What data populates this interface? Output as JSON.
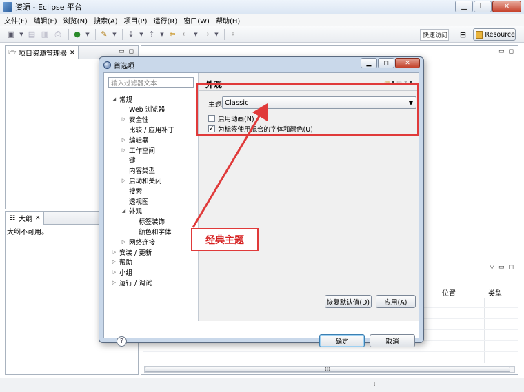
{
  "window": {
    "title": "资源 - Eclipse 平台"
  },
  "menu": [
    "文件(F)",
    "编辑(E)",
    "浏览(N)",
    "搜索(A)",
    "项目(P)",
    "运行(R)",
    "窗口(W)",
    "帮助(H)"
  ],
  "toolbar": {
    "quick_access": "快速访问",
    "perspective_label": "Resource"
  },
  "project_explorer": {
    "title": "项目资源管理器"
  },
  "outline": {
    "title": "大纲",
    "message": "大纲不可用。"
  },
  "table": {
    "columns": [
      "位置",
      "类型"
    ]
  },
  "dialog": {
    "title": "首选项",
    "filter_placeholder": "输入过滤器文本",
    "tree": [
      {
        "label": "常规",
        "toggle": "◢",
        "level": 0
      },
      {
        "label": "Web 浏览器",
        "toggle": "",
        "level": 1
      },
      {
        "label": "安全性",
        "toggle": "▷",
        "level": 1
      },
      {
        "label": "比较 / 应用补丁",
        "toggle": "",
        "level": 1
      },
      {
        "label": "编辑器",
        "toggle": "▷",
        "level": 1
      },
      {
        "label": "工作空间",
        "toggle": "▷",
        "level": 1
      },
      {
        "label": "键",
        "toggle": "",
        "level": 1
      },
      {
        "label": "内容类型",
        "toggle": "",
        "level": 1
      },
      {
        "label": "启动和关闭",
        "toggle": "▷",
        "level": 1
      },
      {
        "label": "搜索",
        "toggle": "",
        "level": 1
      },
      {
        "label": "透视图",
        "toggle": "",
        "level": 1
      },
      {
        "label": "外观",
        "toggle": "◢",
        "level": 1
      },
      {
        "label": "标签装饰",
        "toggle": "",
        "level": 2
      },
      {
        "label": "颜色和字体",
        "toggle": "",
        "level": 2
      },
      {
        "label": "网络连接",
        "toggle": "▷",
        "level": 1
      },
      {
        "label": "安装 / 更新",
        "toggle": "▷",
        "level": 0
      },
      {
        "label": "帮助",
        "toggle": "▷",
        "level": 0
      },
      {
        "label": "小组",
        "toggle": "▷",
        "level": 0
      },
      {
        "label": "运行 / 调试",
        "toggle": "▷",
        "level": 0
      }
    ],
    "page_title": "外观",
    "theme_label": "主题",
    "theme_value": "Classic",
    "enable_animations": {
      "label": "启用动画(N)",
      "checked": false
    },
    "mixed_fonts": {
      "label": "为标签使用混合的字体和颜色(U)",
      "checked": true
    },
    "restore_defaults": "恢复默认值(D)",
    "apply": "应用(A)",
    "ok": "确定",
    "cancel": "取消"
  },
  "annotation": {
    "callout": "经典主题",
    "color": "#e03a3a"
  }
}
